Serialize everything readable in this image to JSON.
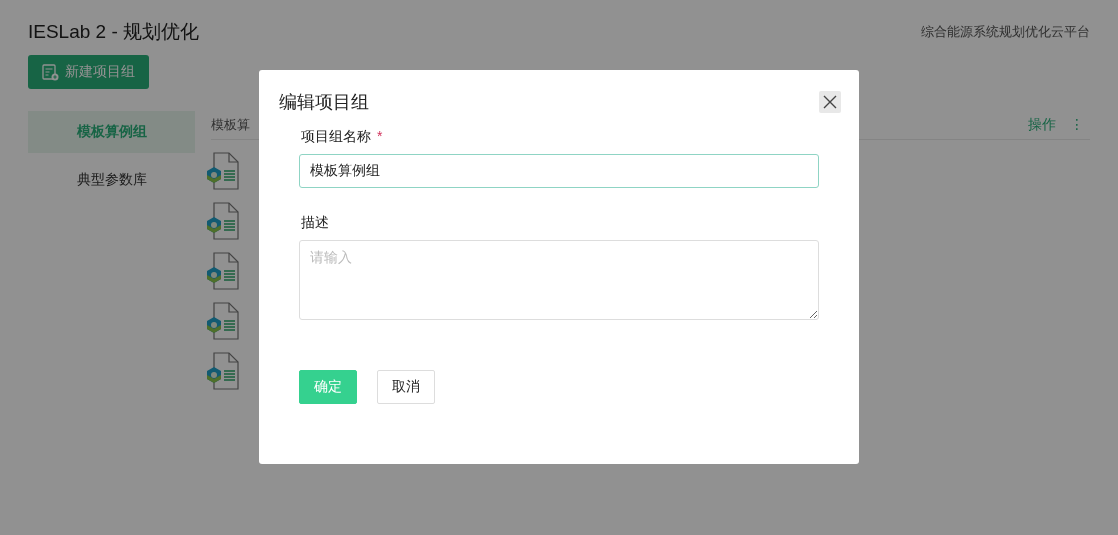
{
  "header": {
    "title": "IESLab 2 - 规划优化",
    "subtitle": "综合能源系统规划优化云平台"
  },
  "new_group_button": {
    "label": "新建项目组"
  },
  "sidebar": {
    "items": [
      {
        "label": "模板算例组",
        "selected": true
      },
      {
        "label": "典型参数库",
        "selected": false
      }
    ]
  },
  "list": {
    "heading": "模板算",
    "action": "操作",
    "more": "⋮",
    "items": [
      {
        "kind": "project"
      },
      {
        "kind": "project"
      },
      {
        "kind": "project"
      },
      {
        "kind": "project"
      },
      {
        "kind": "project"
      }
    ]
  },
  "dialog": {
    "title": "编辑项目组",
    "fields": [
      {
        "kind": "input",
        "label": "项目组名称",
        "required_mark": "*",
        "value": "模板算例组",
        "focused": true
      },
      {
        "kind": "textarea",
        "label": "描述",
        "placeholder": "请输入",
        "focused": false
      }
    ],
    "buttons": [
      {
        "kind": "primary",
        "label": "确定"
      },
      {
        "kind": "default",
        "label": "取消"
      }
    ]
  }
}
